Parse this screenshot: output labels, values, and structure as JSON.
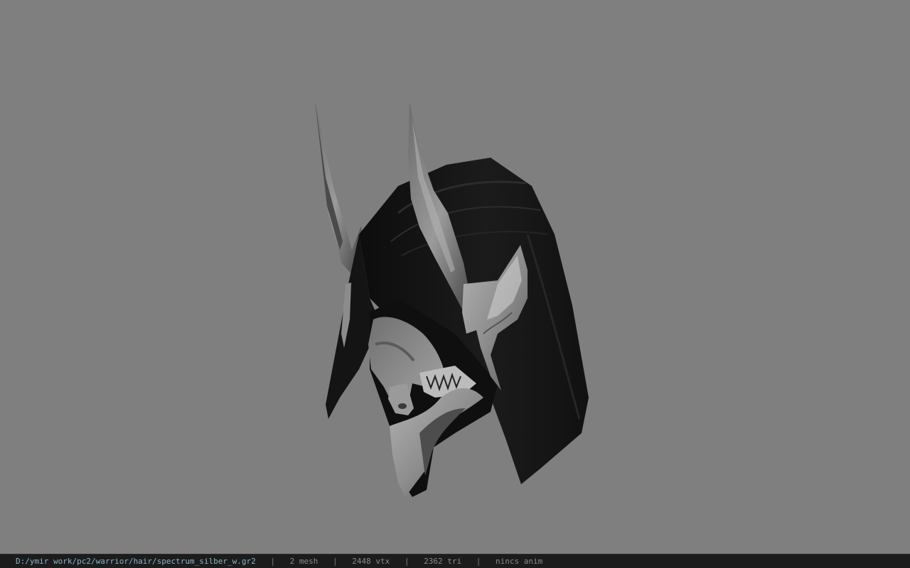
{
  "viewer": {
    "background_color": "#7f7f7f",
    "model_name": "spectrum_silber_w"
  },
  "status": {
    "file_path": "D:/ymir work/pc2/warrior/hair/spectrum_silber_w.gr2",
    "mesh_count": "2 mesh",
    "vertex_count": "2448 vtx",
    "triangle_count": "2362 tri",
    "animation": "nincs anim",
    "separator": "|",
    "path_color": "#86b7c9",
    "text_color": "#8a8a8a"
  }
}
